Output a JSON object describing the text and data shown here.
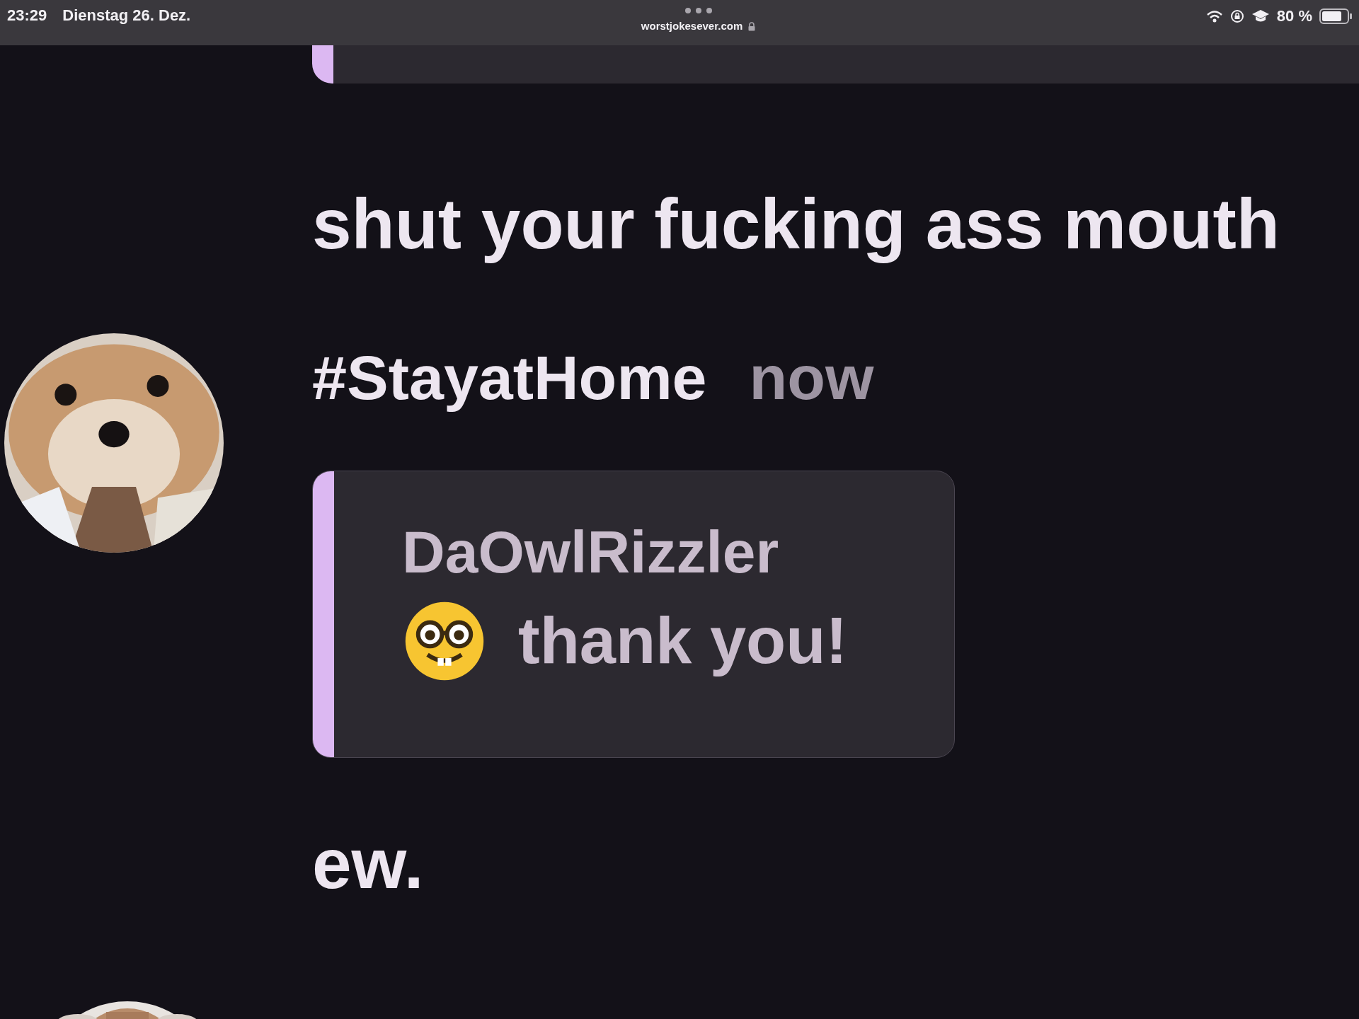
{
  "status_bar": {
    "time": "23:29",
    "date": "Dienstag 26. Dez.",
    "url": "worstjokesever.com",
    "battery": "80 %"
  },
  "feed": [
    {
      "kind": "quote_end"
    },
    {
      "kind": "text",
      "text": "shut your fucking ass mouth"
    },
    {
      "kind": "post",
      "author": "#StayatHome",
      "time": "now",
      "reply": {
        "author": "DaOwlRizzler",
        "text": "thank you!"
      }
    },
    {
      "kind": "text",
      "text": "ew."
    },
    {
      "kind": "avatar_peek"
    }
  ]
}
